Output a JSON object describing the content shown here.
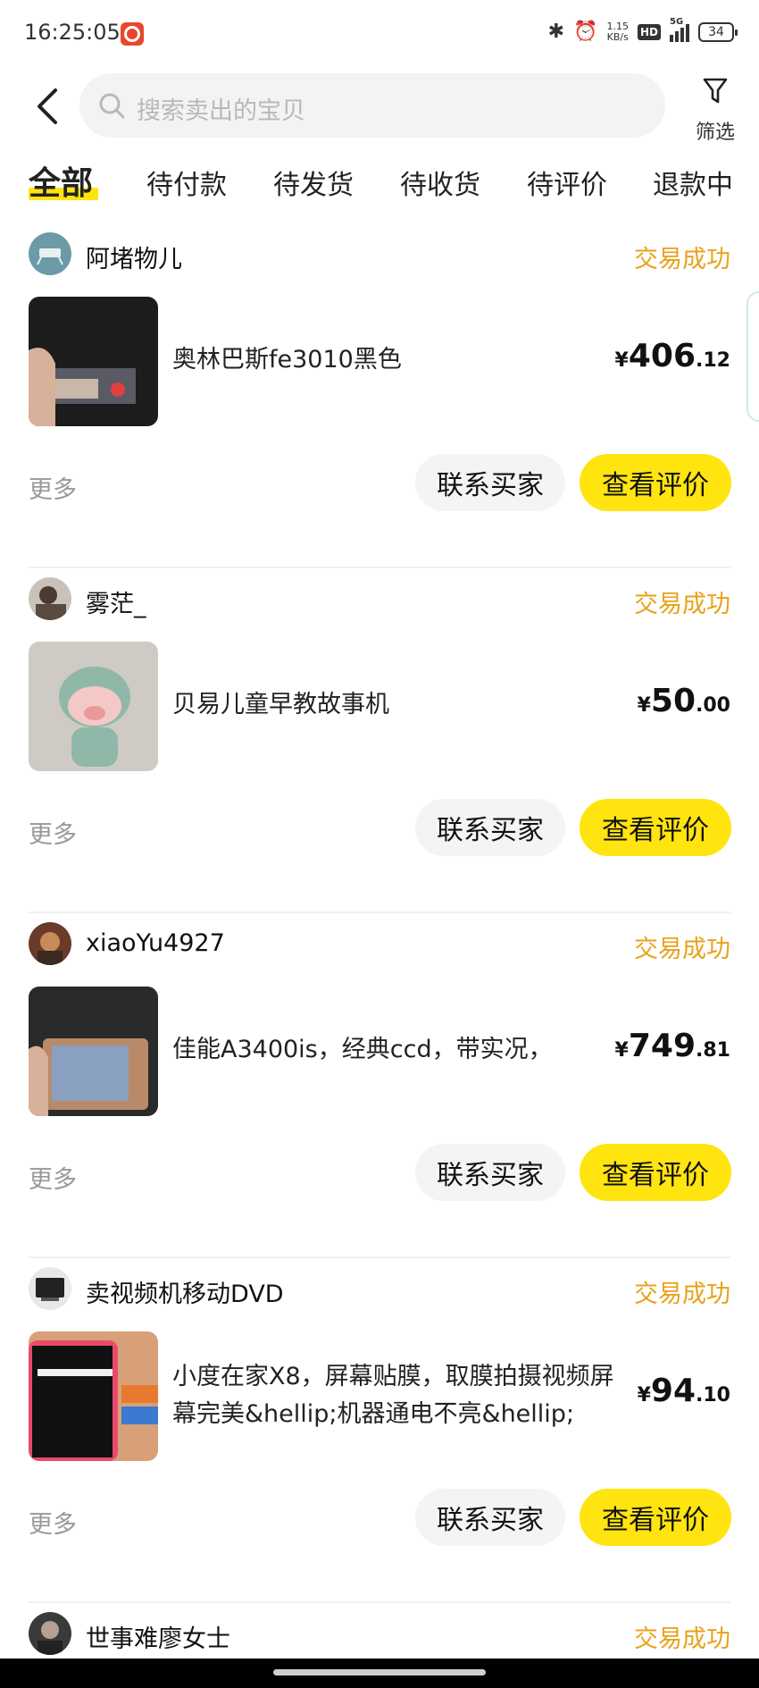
{
  "status_bar": {
    "time": "16:25:05",
    "net_speed_value": "1.15",
    "net_speed_unit": "KB/s",
    "hd": "HD",
    "network": "5G",
    "battery": "34",
    "icons": [
      "netease-music-icon",
      "bluetooth-icon",
      "alarm-icon",
      "signal-icon",
      "battery-icon"
    ]
  },
  "header": {
    "search_placeholder": "搜索卖出的宝贝",
    "filter_label": "筛选"
  },
  "tabs": [
    {
      "label": "全部",
      "active": true
    },
    {
      "label": "待付款"
    },
    {
      "label": "待发货"
    },
    {
      "label": "待收货"
    },
    {
      "label": "待评价"
    },
    {
      "label": "退款中"
    }
  ],
  "colors": {
    "accent_yellow": "#ffe40f",
    "status_orange": "#e8a21a",
    "muted_gray": "#999999"
  },
  "orders": [
    {
      "buyer": "阿堵物儿",
      "status": "交易成功",
      "title": "奥林巴斯fe3010黑色",
      "price_currency": "¥",
      "price_int": "406",
      "price_dec": ".12",
      "more": "更多",
      "contact": "联系买家",
      "review": "查看评价"
    },
    {
      "buyer": "雾茫_",
      "status": "交易成功",
      "title": "贝易儿童早教故事机",
      "price_currency": "¥",
      "price_int": "50",
      "price_dec": ".00",
      "more": "更多",
      "contact": "联系买家",
      "review": "查看评价"
    },
    {
      "buyer": "xiaoYu4927",
      "status": "交易成功",
      "title": "佳能A3400is，经典ccd，带实况，",
      "price_currency": "¥",
      "price_int": "749",
      "price_dec": ".81",
      "more": "更多",
      "contact": "联系买家",
      "review": "查看评价"
    },
    {
      "buyer": "卖视频机移动DVD",
      "status": "交易成功",
      "title": "小度在家X8，屏幕贴膜，取膜拍摄视频屏幕完美&hellip;机器通电不亮&hellip;",
      "price_currency": "¥",
      "price_int": "94",
      "price_dec": ".10",
      "more": "更多",
      "contact": "联系买家",
      "review": "查看评价"
    },
    {
      "buyer": "世事难廖女士",
      "status": "交易成功"
    }
  ]
}
